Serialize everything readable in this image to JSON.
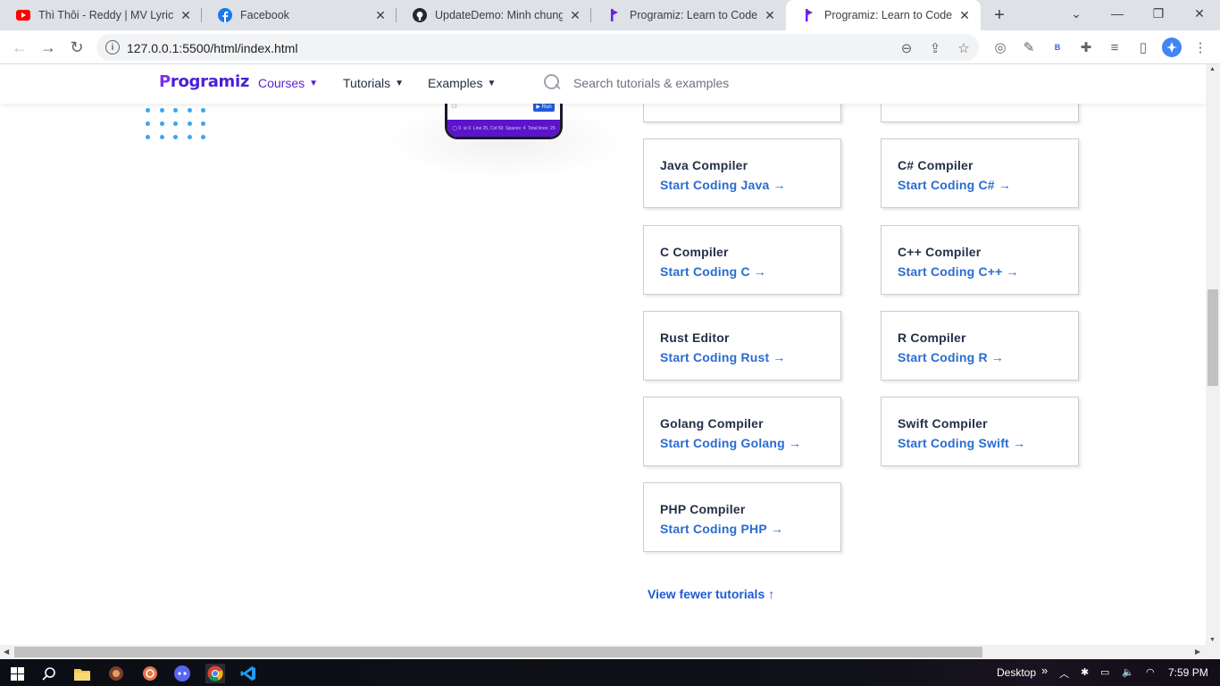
{
  "browser": {
    "tabs": [
      {
        "title": "Thì Thôi - Reddy | MV Lyrics HD",
        "icon": "youtube-icon",
        "active": false
      },
      {
        "title": "Facebook",
        "icon": "facebook-icon",
        "active": false
      },
      {
        "title": "UpdateDemo: Minh chung cho",
        "icon": "github-icon",
        "active": false
      },
      {
        "title": "Programiz: Learn to Code for Free",
        "icon": "programiz-icon",
        "active": false
      },
      {
        "title": "Programiz: Learn to Code for Free",
        "icon": "programiz-icon",
        "active": true
      }
    ],
    "url": "127.0.0.1:5500/html/index.html",
    "profile_letter": "B"
  },
  "site": {
    "logo": {
      "first": "P",
      "rest": "rogramiz"
    },
    "nav": {
      "courses": "Courses",
      "tutorials": "Tutorials",
      "examples": "Examples"
    },
    "search_placeholder": "Search tutorials & examples",
    "phone": {
      "run": "▶ Run",
      "line": "13",
      "status": [
        "◯ 0",
        "⊘ 0",
        "Line 25, Col 50",
        "Spaces: 4",
        "Total lines: 25"
      ]
    }
  },
  "cards": [
    {
      "title": "Java Compiler",
      "link": "Start Coding Java"
    },
    {
      "title": "C# Compiler",
      "link": "Start Coding C#"
    },
    {
      "title": "C Compiler",
      "link": "Start Coding C"
    },
    {
      "title": "C++ Compiler",
      "link": "Start Coding C++"
    },
    {
      "title": "Rust Editor",
      "link": "Start Coding Rust"
    },
    {
      "title": "R Compiler",
      "link": "Start Coding R"
    },
    {
      "title": "Golang Compiler",
      "link": "Start Coding Golang"
    },
    {
      "title": "Swift Compiler",
      "link": "Start Coding Swift"
    },
    {
      "title": "PHP Compiler",
      "link": "Start Coding PHP"
    }
  ],
  "view_fewer": "View fewer tutorials",
  "taskbar": {
    "desktop_label": "Desktop",
    "time": "7:59 PM"
  },
  "colors": {
    "brand_purple": "#5c1ed2",
    "link_blue": "#2a6ccf",
    "text_dark": "#253048"
  }
}
